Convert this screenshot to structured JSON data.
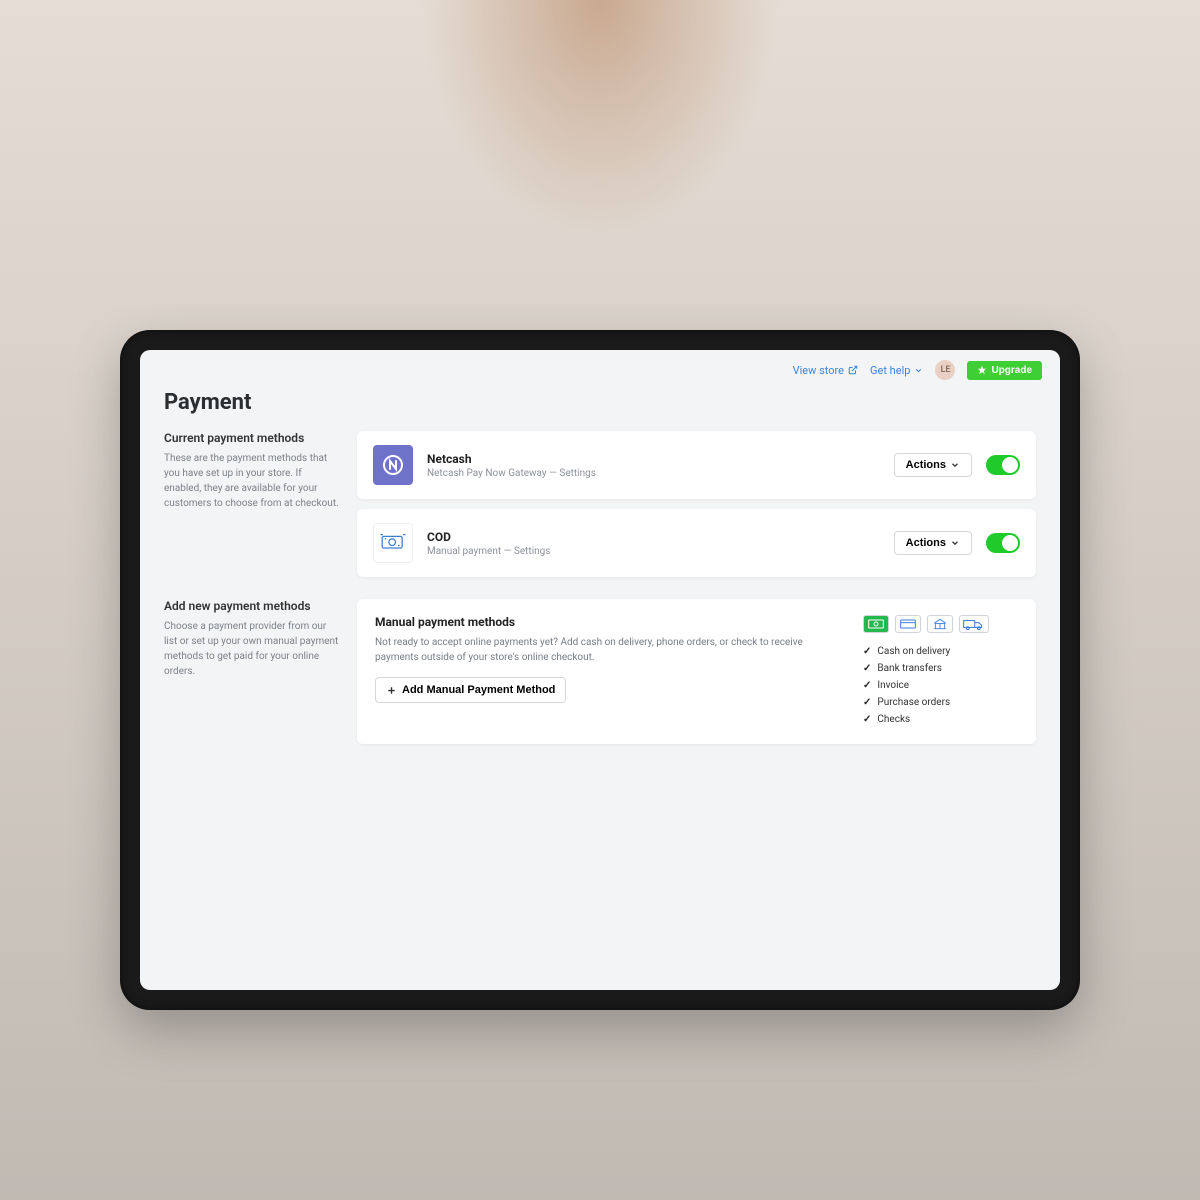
{
  "header": {
    "view_store": "View store",
    "get_help": "Get help",
    "avatar_initials": "LE",
    "upgrade": "Upgrade"
  },
  "page": {
    "title": "Payment"
  },
  "sections": {
    "current": {
      "title": "Current payment methods",
      "desc": "These are the payment methods that you have set up in your store. If enabled, they are available for your customers to choose from at checkout."
    },
    "add_new": {
      "title": "Add new payment methods",
      "desc": "Choose a payment provider from our list or set up your own manual payment methods to get paid for your online orders."
    }
  },
  "providers": [
    {
      "name": "Netcash",
      "sub": "Netcash Pay Now Gateway — Settings",
      "actions_label": "Actions",
      "enabled": true
    },
    {
      "name": "COD",
      "sub": "Manual payment — Settings",
      "actions_label": "Actions",
      "enabled": true
    }
  ],
  "manual": {
    "title": "Manual payment methods",
    "desc": "Not ready to accept online payments yet? Add cash on delivery, phone orders, or check to receive payments outside of your store's online checkout.",
    "add_button": "Add Manual Payment Method",
    "features": [
      "Cash on delivery",
      "Bank transfers",
      "Invoice",
      "Purchase orders",
      "Checks"
    ]
  }
}
